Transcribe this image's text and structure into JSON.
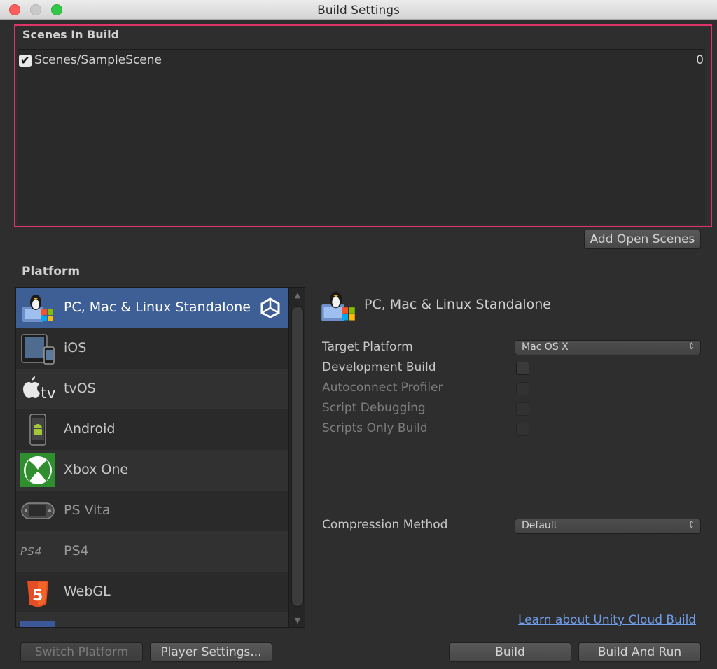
{
  "window": {
    "title": "Build Settings"
  },
  "scenes": {
    "header": "Scenes In Build",
    "items": [
      {
        "name": "Scenes/SampleScene",
        "index": "0",
        "checked": true
      }
    ],
    "add_open_scenes_label": "Add Open Scenes"
  },
  "platform": {
    "header": "Platform",
    "items": [
      {
        "name": "PC, Mac & Linux Standalone",
        "icon": "pc-mac-linux-icon",
        "selected": true
      },
      {
        "name": "iOS",
        "icon": "ios-devices-icon"
      },
      {
        "name": "tvOS",
        "icon": "apple-tv-icon"
      },
      {
        "name": "Android",
        "icon": "android-phone-icon"
      },
      {
        "name": "Xbox One",
        "icon": "xbox-icon"
      },
      {
        "name": "PS Vita",
        "icon": "ps-vita-icon"
      },
      {
        "name": "PS4",
        "icon": "ps4-icon"
      },
      {
        "name": "WebGL",
        "icon": "html5-icon"
      }
    ]
  },
  "detail": {
    "title": "PC, Mac & Linux Standalone",
    "target_platform_label": "Target Platform",
    "target_platform_value": "Mac OS X",
    "development_build_label": "Development Build",
    "autoconnect_profiler_label": "Autoconnect Profiler",
    "script_debugging_label": "Script Debugging",
    "scripts_only_build_label": "Scripts Only Build",
    "compression_method_label": "Compression Method",
    "compression_method_value": "Default",
    "cloud_build_link": "Learn about Unity Cloud Build"
  },
  "footer": {
    "switch_platform_label": "Switch Platform",
    "player_settings_label": "Player Settings...",
    "build_label": "Build",
    "build_and_run_label": "Build And Run"
  },
  "colors": {
    "highlight_border": "#e0336a",
    "selected_row": "#3e5f96",
    "link": "#6f9ce8"
  }
}
